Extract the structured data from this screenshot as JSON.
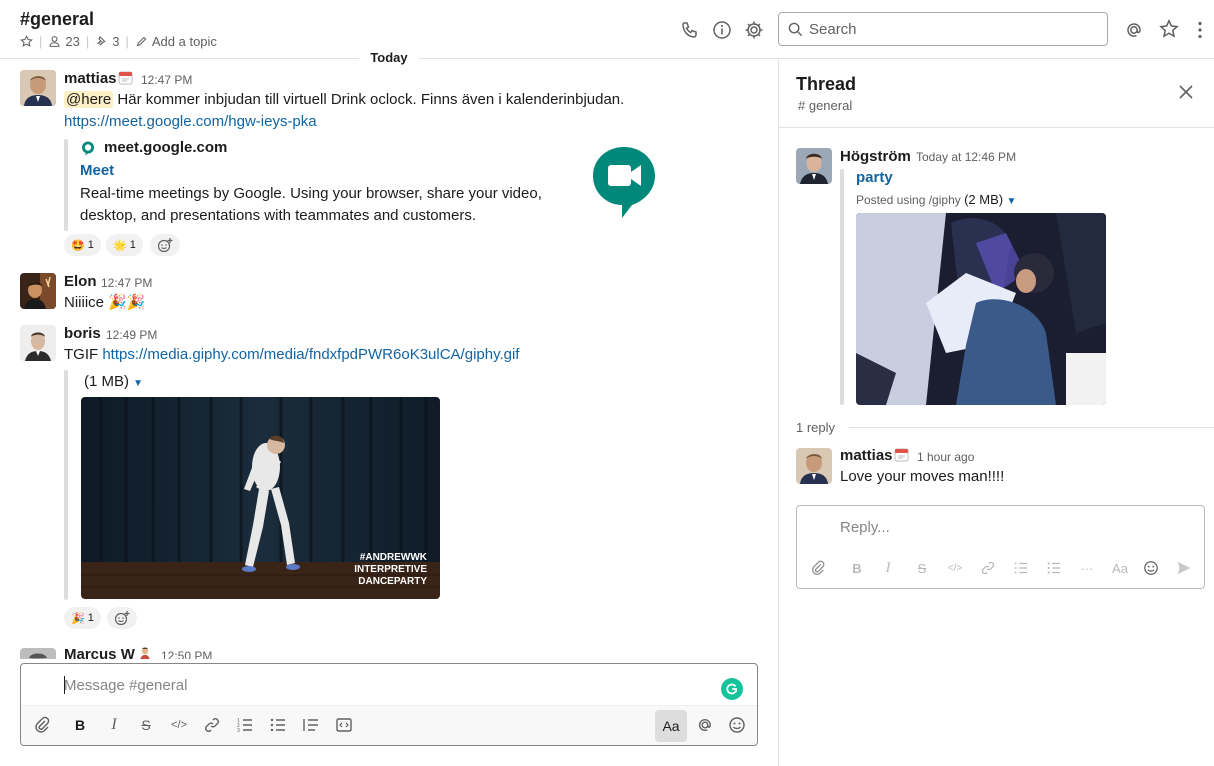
{
  "header": {
    "channel": "#general",
    "members": "23",
    "pins": "3",
    "add_topic": "Add a topic",
    "search_placeholder": "Search"
  },
  "divider": {
    "label": "Today"
  },
  "messages": [
    {
      "user": "mattias",
      "time": "12:47 PM",
      "mention": "@here",
      "text": " Här kommer inbjudan till virtuell Drink oclock. Finns även i kalenderinbjudan.",
      "link": "https://meet.google.com/hgw-ieys-pka",
      "unfurl": {
        "site": "meet.google.com",
        "title": "Meet",
        "desc_line1": "Real-time meetings by Google. Using your browser, share your video,",
        "desc_line2": "desktop, and presentations with teammates and customers."
      },
      "reactions": [
        {
          "emoji": "🤩",
          "count": "1"
        },
        {
          "emoji": "🌟",
          "count": "1"
        }
      ]
    },
    {
      "user": "Elon",
      "time": "12:47 PM",
      "text": "Niiiice 🎉🎉"
    },
    {
      "user": "boris",
      "time": "12:49 PM",
      "text": "TGIF ",
      "link": "https://media.giphy.com/media/fndxfpdPWR6oK3ulCA/giphy.gif",
      "gif_size": "(1 MB)",
      "gif_caption_line1": "#ANDREWWK",
      "gif_caption_line2": "INTERPRETIVE",
      "gif_caption_line3": "DANCEPARTY",
      "reactions": [
        {
          "emoji": "🎉",
          "count": "1"
        }
      ]
    },
    {
      "user": "Marcus W",
      "time": "12:50 PM"
    }
  ],
  "composer": {
    "placeholder": "Message #general",
    "aa": "Aa"
  },
  "thread": {
    "title": "Thread",
    "channel": "# general",
    "parent": {
      "user": "Högström",
      "time": "Today at 12:46 PM",
      "title": "party",
      "posted_using": "Posted using /giphy",
      "size": "(2 MB)"
    },
    "reply_count": "1 reply",
    "reply": {
      "user": "mattias",
      "time": "1 hour ago",
      "text": "Love your moves man!!!!"
    },
    "reply_placeholder": "Reply...",
    "aa": "Aa"
  },
  "colors": {
    "link": "#1264a3",
    "meet_green": "#00897b",
    "grammarly": "#15c39a"
  }
}
